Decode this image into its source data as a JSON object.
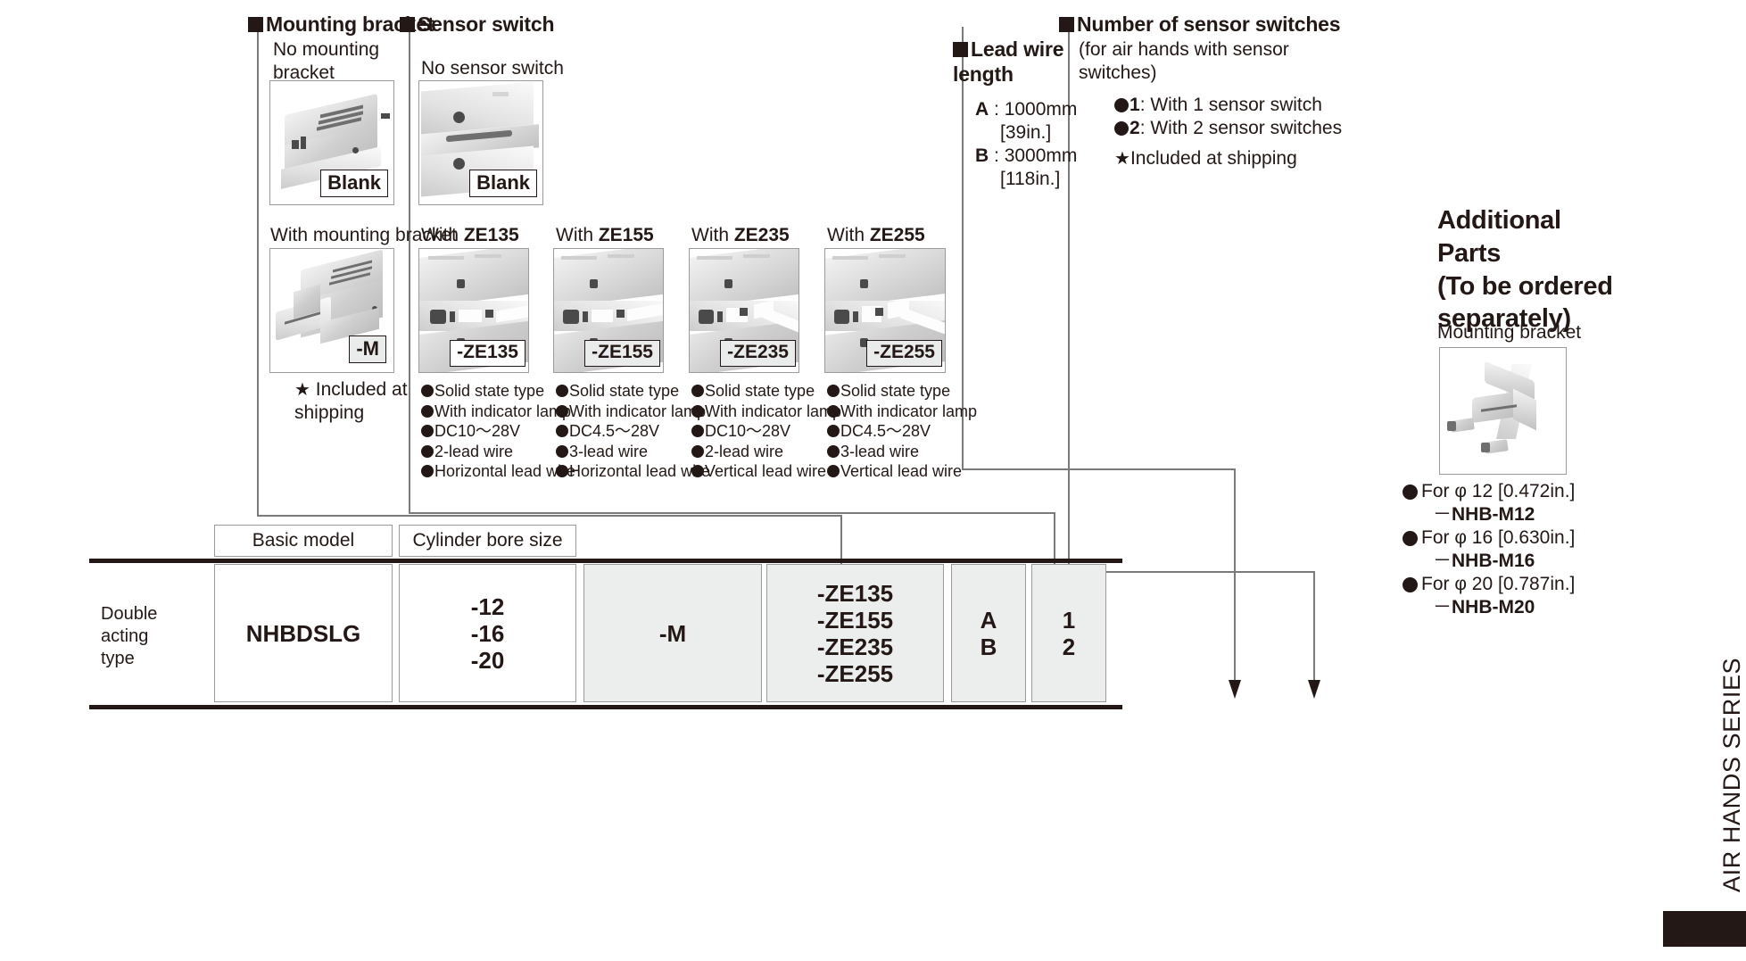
{
  "sections": {
    "mounting_bracket": {
      "heading": "Mounting bracket",
      "option_none_caption": "No mounting\nbracket",
      "option_none_badge": "Blank",
      "option_with_caption": "With mounting bracket",
      "option_with_badge": "-M",
      "note": "Included at\nshipping",
      "note_marker": "★"
    },
    "sensor_switch": {
      "heading": "Sensor switch",
      "option_none_caption": "No sensor switch",
      "option_none_badge": "Blank",
      "options": [
        {
          "caption_prefix": "With ",
          "caption_code": "ZE135",
          "badge": "-ZE135",
          "specs": [
            "Solid state type",
            "With indicator lamp",
            "DC10～28V",
            "2-lead wire",
            "Horizontal lead wire"
          ]
        },
        {
          "caption_prefix": "With ",
          "caption_code": "ZE155",
          "badge": "-ZE155",
          "specs": [
            "Solid state type",
            "With indicator lamp",
            "DC4.5～28V",
            "3-lead wire",
            "Horizontal lead wire"
          ]
        },
        {
          "caption_prefix": "With ",
          "caption_code": "ZE235",
          "badge": "-ZE235",
          "specs": [
            "Solid state type",
            "With indicator lamp",
            "DC10～28V",
            "2-lead wire",
            "Vertical lead wire"
          ]
        },
        {
          "caption_prefix": "With ",
          "caption_code": "ZE255",
          "badge": "-ZE255",
          "specs": [
            "Solid state type",
            "With indicator lamp",
            "DC4.5～28V",
            "3-lead wire",
            "Vertical lead wire"
          ]
        }
      ]
    },
    "lead_wire_length": {
      "heading": "Lead wire\nlength",
      "items": [
        {
          "code": "A",
          "sep": " : ",
          "value": "1000mm",
          "alt": "[39in.]"
        },
        {
          "code": "B",
          "sep": " : ",
          "value": "3000mm",
          "alt": "[118in.]"
        }
      ]
    },
    "number_of_sensor_switches": {
      "heading": "Number of sensor switches",
      "subtitle": "(for air hands with sensor\nswitches)",
      "items": [
        {
          "code": "1",
          "text": " : With 1 sensor switch"
        },
        {
          "code": "2",
          "text": " : With 2 sensor switches"
        }
      ],
      "note_marker": "★",
      "note": "Included at shipping"
    },
    "additional_parts": {
      "title": "Additional\nParts\n (To be ordered\nseparately)",
      "subtitle": "Mounting bracket",
      "items": [
        {
          "bullet_text": "For  φ 12 [0.472in.]",
          "code_dash": "－",
          "code": "NHB-M12"
        },
        {
          "bullet_text": "For  φ 16 [0.630in.]",
          "code_dash": "－",
          "code": "NHB-M16"
        },
        {
          "bullet_text": "For  φ 20 [0.787in.]",
          "code_dash": "－",
          "code": "NHB-M20"
        }
      ]
    }
  },
  "model_table": {
    "headers": [
      {
        "label": "Basic model"
      },
      {
        "label": "Cylinder bore size"
      }
    ],
    "row_label": "Double\nacting\ntype",
    "cells": [
      {
        "name": "basic-model",
        "value": "NHBDSLG",
        "gray": false
      },
      {
        "name": "cylinder-bore-size",
        "value": "-12\n-16\n-20",
        "gray": false
      },
      {
        "name": "mounting-bracket-code",
        "value": "-M",
        "gray": true
      },
      {
        "name": "sensor-switch-code",
        "value": "-ZE135\n-ZE155\n-ZE235\n-ZE255",
        "gray": true
      },
      {
        "name": "lead-wire-length-code",
        "value": "A\nB",
        "gray": true
      },
      {
        "name": "sensor-switch-count-code",
        "value": "1\n2",
        "gray": true
      }
    ]
  },
  "series_label": "AIR HANDS SERIES",
  "colors": {
    "ink": "#231815",
    "rule": "#9b9b9b",
    "cell_gray": "#eceeed"
  }
}
